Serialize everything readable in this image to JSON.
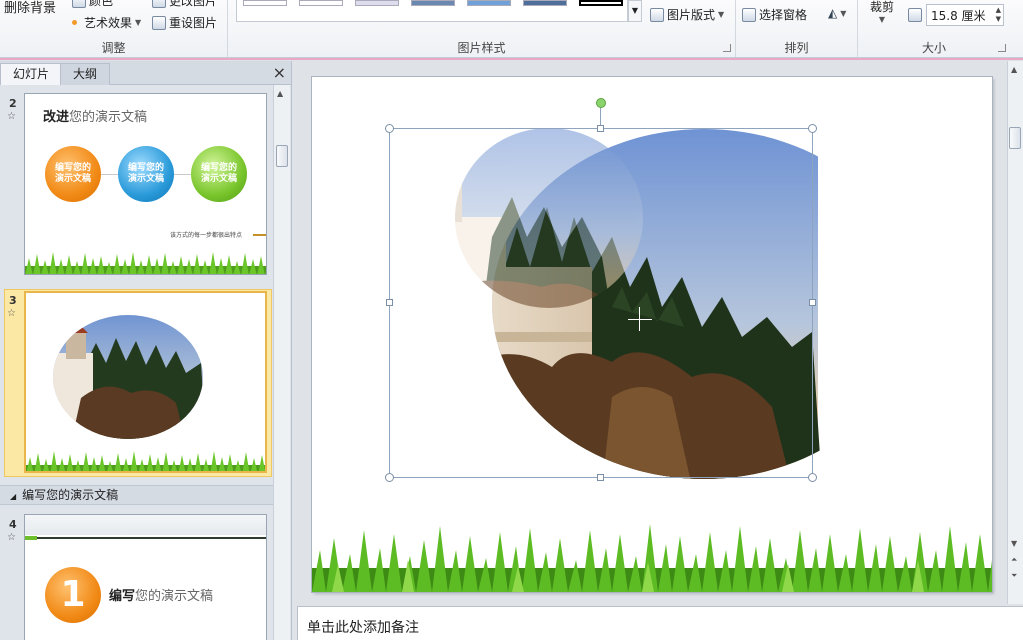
{
  "ribbon": {
    "adjust": {
      "remove_bg": "删除背景",
      "color_label": "颜色",
      "art_effects": "艺术效果",
      "change_picture": "更改图片",
      "reset_picture": "重设图片",
      "group_label": "调整"
    },
    "picture_styles": {
      "group_label": "图片样式",
      "layout_btn": "图片版式"
    },
    "arrange": {
      "selection_pane": "选择窗格",
      "group_label": "排列"
    },
    "size": {
      "crop": "裁剪",
      "width_value": "15.8 厘米",
      "group_label": "大小"
    }
  },
  "left_pane": {
    "tabs": [
      "幻灯片",
      "大纲"
    ],
    "close": "×",
    "slides": [
      {
        "num": "2",
        "title_bold": "改进",
        "title_rest": "您的演示文稿",
        "circles": [
          "编写您的\n演示文稿",
          "编写您的\n演示文稿",
          "编写您的\n演示文稿"
        ],
        "footer": "该方式的每一步都很出特点"
      },
      {
        "num": "3"
      },
      {
        "num": "4",
        "title_bold": "编写",
        "title_rest": "您的演示文稿",
        "circle_num": "1"
      }
    ],
    "section_title": "编写您的演示文稿"
  },
  "notes": {
    "placeholder": "单击此处添加备注"
  },
  "colors": {
    "ribbon_accent": "#e9a8c6",
    "selected_slide": "#fbe8a4",
    "orange": "#f18a16",
    "blue": "#2a9ad9",
    "green": "#79c52c"
  }
}
